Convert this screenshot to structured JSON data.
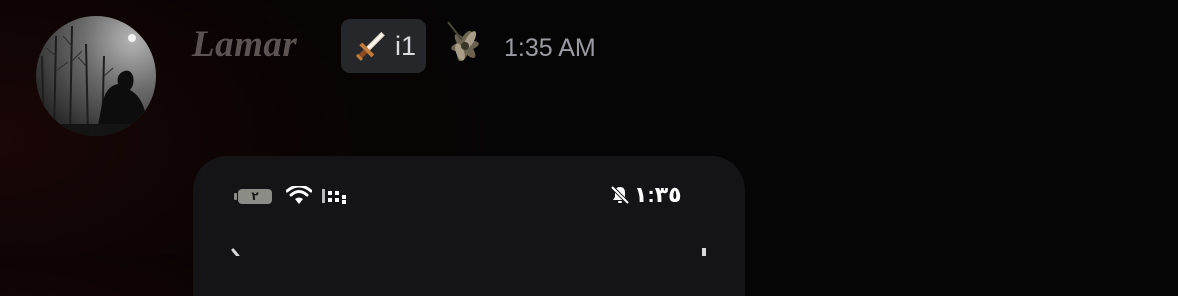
{
  "message": {
    "author": "Lamar",
    "role_tag": {
      "icon": "sword-icon",
      "text": "i1"
    },
    "decoration_icon": "flower-icon",
    "timestamp": "1:35 AM"
  },
  "embed": {
    "status_bar": {
      "time": "١:٣٥",
      "battery_label": "٢",
      "icons": [
        "silent-bell-icon",
        "wifi-icon",
        "signal-icon",
        "battery-icon"
      ]
    }
  }
}
